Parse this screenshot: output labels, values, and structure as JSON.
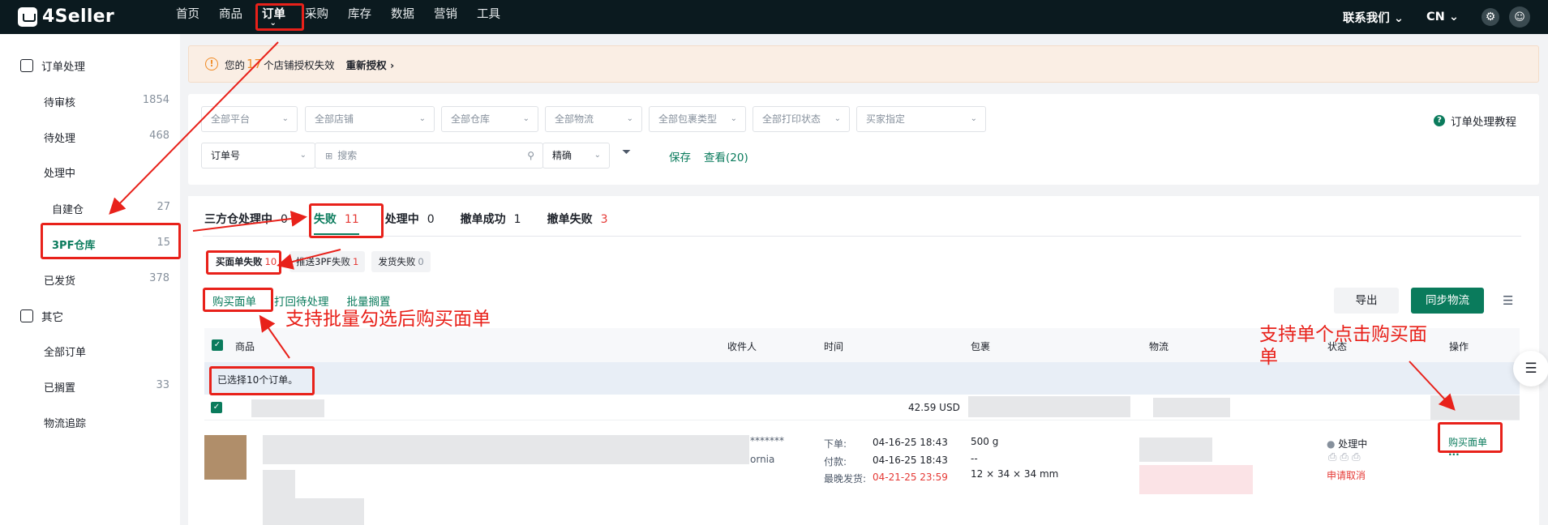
{
  "topbar": {
    "logo": "4Seller",
    "nav": [
      "首页",
      "商品",
      "订单",
      "采购",
      "库存",
      "数据",
      "营销",
      "工具"
    ],
    "active_caret": "⌄",
    "contact": "联系我们 ⌄",
    "lang": "CN ⌄"
  },
  "sidebar": {
    "section1": "订单处理",
    "items1": [
      {
        "label": "待审核",
        "count": "1854"
      },
      {
        "label": "待处理",
        "count": "468"
      },
      {
        "label": "处理中",
        "count": ""
      }
    ],
    "subitems": [
      {
        "label": "自建仓",
        "count": "27"
      },
      {
        "label": "3PF仓库",
        "count": "15"
      }
    ],
    "shipped": {
      "label": "已发货",
      "count": "378"
    },
    "section2": "其它",
    "items2": [
      {
        "label": "全部订单",
        "count": ""
      },
      {
        "label": "已搁置",
        "count": "33"
      },
      {
        "label": "物流追踪",
        "count": ""
      }
    ]
  },
  "alert": {
    "pre": "您的",
    "num": "17",
    "post": "个店铺授权失效",
    "link": "重新授权 ›"
  },
  "filters": {
    "row1": [
      "全部平台",
      "全部店铺",
      "全部仓库",
      "全部物流",
      "全部包裹类型",
      "全部打印状态",
      "买家指定"
    ],
    "order_no": "订单号",
    "search_placeholder": "搜索",
    "precise": "精确",
    "save": "保存",
    "view": "查看(20)",
    "tutorial": "订单处理教程"
  },
  "tabs": [
    {
      "label": "三方仓处理中",
      "count": "0"
    },
    {
      "label": "失败",
      "count": "11"
    },
    {
      "label": "处理中",
      "count": "0"
    },
    {
      "label": "撤单成功",
      "count": "1"
    },
    {
      "label": "撤单失败",
      "count": "3"
    }
  ],
  "subtabs": [
    {
      "label": "买面单失败",
      "count": "10"
    },
    {
      "label": "推送3PF失败",
      "count": "1"
    },
    {
      "label": "发货失败",
      "count": "0"
    }
  ],
  "actions": {
    "buy_label": "购买面单",
    "print_pending": "打回待处理",
    "bulk_hold": "批量搁置",
    "export": "导出",
    "sync": "同步物流"
  },
  "table": {
    "headers": {
      "product": "商品",
      "recipient": "收件人",
      "time": "时间",
      "package": "包裹",
      "logistics": "物流",
      "status": "状态",
      "operation": "操作"
    },
    "selected_text": "已选择10个订单。",
    "amount": "42.59 USD",
    "row": {
      "recipient_mask": "*******",
      "recipient_state": "ornia",
      "order_label": "下单:",
      "order_time": "04-16-25 18:43",
      "pay_label": "付款:",
      "pay_time": "04-16-25 18:43",
      "ship_label": "最晚发货:",
      "ship_time": "04-21-25 23:59",
      "weight": "500 g",
      "dash": "--",
      "dims": "12 × 34 × 34 mm",
      "status": "处理中",
      "cancel": "申请取消",
      "buy": "购买面单",
      "more": "···"
    }
  },
  "annotations": {
    "batch": "支持批量勾选后购买面单",
    "single": "支持单个点击购买面单"
  },
  "colors": {
    "brand": "#0a7b5c",
    "annotation": "#e8211a",
    "topbar": "#0b1a1f"
  }
}
